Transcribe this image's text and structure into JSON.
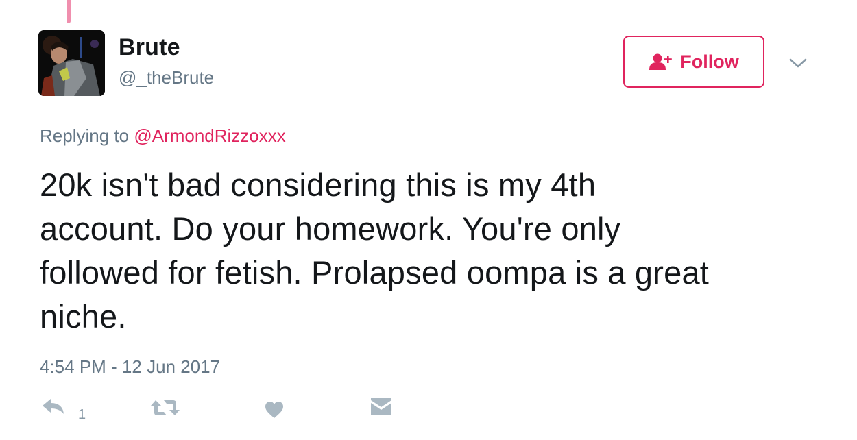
{
  "tweet": {
    "author": {
      "display_name": "Brute",
      "handle": "@_theBrute",
      "avatar_icon": "profile-photo"
    },
    "follow_button": {
      "label": "Follow",
      "icon": "add-user-icon",
      "color": "#e0245e"
    },
    "more_menu_icon": "chevron-down-icon",
    "reply_context": {
      "prefix": "Replying to",
      "mention": "@ArmondRizzoxxx"
    },
    "text_lines": [
      "20k isn't bad considering this is my 4th",
      "account. Do your homework. You're only",
      "followed for fetish. Prolapsed oompa is a great",
      "niche."
    ],
    "timestamp": "4:54 PM - 12 Jun 2017",
    "actions": {
      "reply": {
        "icon": "reply-icon",
        "count": "1"
      },
      "retweet": {
        "icon": "retweet-icon"
      },
      "like": {
        "icon": "heart-icon"
      },
      "direct_message": {
        "icon": "envelope-icon"
      }
    },
    "colors": {
      "accent": "#e0245e",
      "thread_line": "#f08fae",
      "secondary_text": "#657786",
      "action_icons": "#aab8c2"
    }
  }
}
